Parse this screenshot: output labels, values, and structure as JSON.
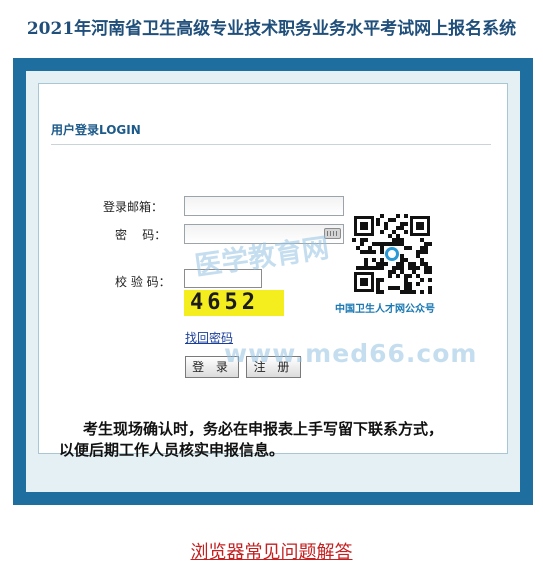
{
  "page_title": "2021年河南省卫生高级专业技术职务业务水平考试网上报名系统",
  "panel": {
    "header": "用户登录LOGIN",
    "fields": {
      "email_label": "登录邮箱：",
      "email_value": "",
      "password_label": "密    码：",
      "password_value": "",
      "captcha_label": "校 验 码：",
      "captcha_value": "",
      "captcha_image_text": "4652"
    },
    "forgot_password": "找回密码",
    "login_button": "登 录",
    "register_button": "注 册",
    "qr_caption": "中国卫生人才网公众号",
    "notice_line1": "考生现场确认时，务必在申报表上手写留下联系方式，",
    "notice_line2": "以便后期工作人员核实申报信息。",
    "watermark_cn": "医学教育网",
    "watermark_url": "www.med66.com"
  },
  "footer": {
    "faq_link": "浏览器常见问题解答"
  },
  "colors": {
    "frame_blue": "#1e6fa0",
    "frame_light": "#e4f0f3",
    "title_blue": "#1f4f7a",
    "captcha_bg": "#f5ee1f",
    "faq_red": "#c42020"
  }
}
